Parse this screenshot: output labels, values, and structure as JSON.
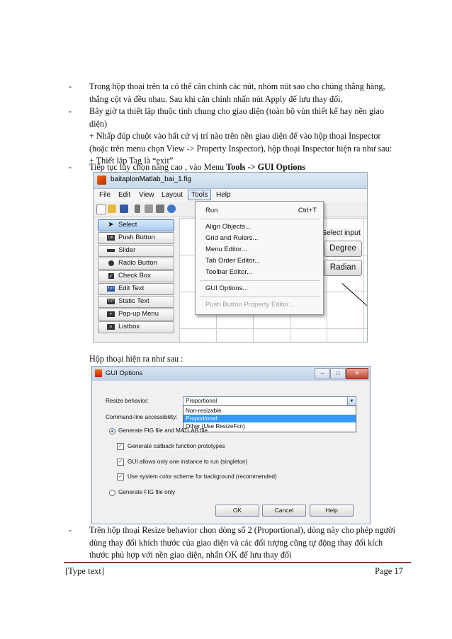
{
  "bullets_top": [
    {
      "dash": "-",
      "lines": [
        "Trong hộp thoại trên ta có thể căn chỉnh các nút, nhóm nút sao cho chúng thẳng hàng,",
        "thẳng cột và đều nhau. Sau khi căn chỉnh nhấn nút Apply để lưu thay đổi."
      ]
    },
    {
      "dash": "-",
      "lines": [
        "Bây giờ ta thiết lập thuộc tính chung cho giao diện (toàn bộ vùn thiết kế hay nền giao",
        "diện)",
        "+ Nhấp đúp chuột vào bất cứ vị trí nào trên nền giao diện để vào hộp thoại Inspector",
        "(hoặc trên menu chọn View -> Property Inspector), hộp thoại Inspector hiện ra như sau:",
        "+ Thiết lập Tag là “exit”"
      ]
    },
    {
      "dash": "-",
      "text_pre": "Tiếp tục tùy chọn nâng cao , vào Menu ",
      "text_bold": "Tools -> GUI Options"
    }
  ],
  "guide_window": {
    "title": "baitaplonMatlab_bai_1.fig",
    "menu": [
      "File",
      "Edit",
      "View",
      "Layout",
      "Tools",
      "Help"
    ],
    "palette": [
      {
        "label": "Select",
        "icon": "arrow-icon"
      },
      {
        "label": "Push Button",
        "icon": "ok"
      },
      {
        "label": "Slider",
        "icon": "slider"
      },
      {
        "label": "Radio Button",
        "icon": "radio"
      },
      {
        "label": "Check Box",
        "icon": "check"
      },
      {
        "label": "Edit Text",
        "icon": "EDIT"
      },
      {
        "label": "Static Text",
        "icon": "TXT"
      },
      {
        "label": "Pop-up Menu",
        "icon": "popup"
      },
      {
        "label": "Listbox",
        "icon": "list"
      }
    ],
    "tools_menu": {
      "run": "Run",
      "run_shortcut": "Ctrl+T",
      "items": [
        "Align Objects...",
        "Grid and Rulers...",
        "Menu Editor...",
        "Tab Order Editor...",
        "Toolbar Editor..."
      ],
      "gui_options": "GUI Options...",
      "disabled": "Push Button Property Editor..."
    },
    "canvas": {
      "select_input": "Select input",
      "btn1": "Degree",
      "btn2": "Radian"
    },
    "highlight_color": "#f2e800"
  },
  "caption": "Hộp thoại hiện ra như sau :",
  "gui_options_dialog": {
    "title": "GUI Options",
    "resize_label": "Resize behavior:",
    "resize_value": "Proportional",
    "options": [
      "Non-resizable",
      "Proportional",
      "Other (Use ResizeFcn)"
    ],
    "selected_option": 1,
    "cmdline_label": "Command-line accessibility:",
    "radio1": "Generate FIG file and MATLAB file",
    "check1": "Generate callback function prototypes",
    "check2": "GUI allows only one instance to run (singleton)",
    "check3": "Use system color scheme for background (recommended)",
    "radio2": "Generate FIG file only",
    "ok": "OK",
    "cancel": "Cancel",
    "help": "Help"
  },
  "bullet_bottom": {
    "dash": "-",
    "lines": [
      "Trên hộp thoại Resize behavior chọn dòng số 2 (Proportional), dòng này cho phép người",
      "dùng thay đổi khích thước của giao diện và các đối tượng cũng tự động thay đổi kích",
      "thước phủ hợp với nền giao diện, nhấn OK để lưu thay đổi"
    ]
  },
  "footer": {
    "left": "[Type text]",
    "right": "Page 17"
  }
}
